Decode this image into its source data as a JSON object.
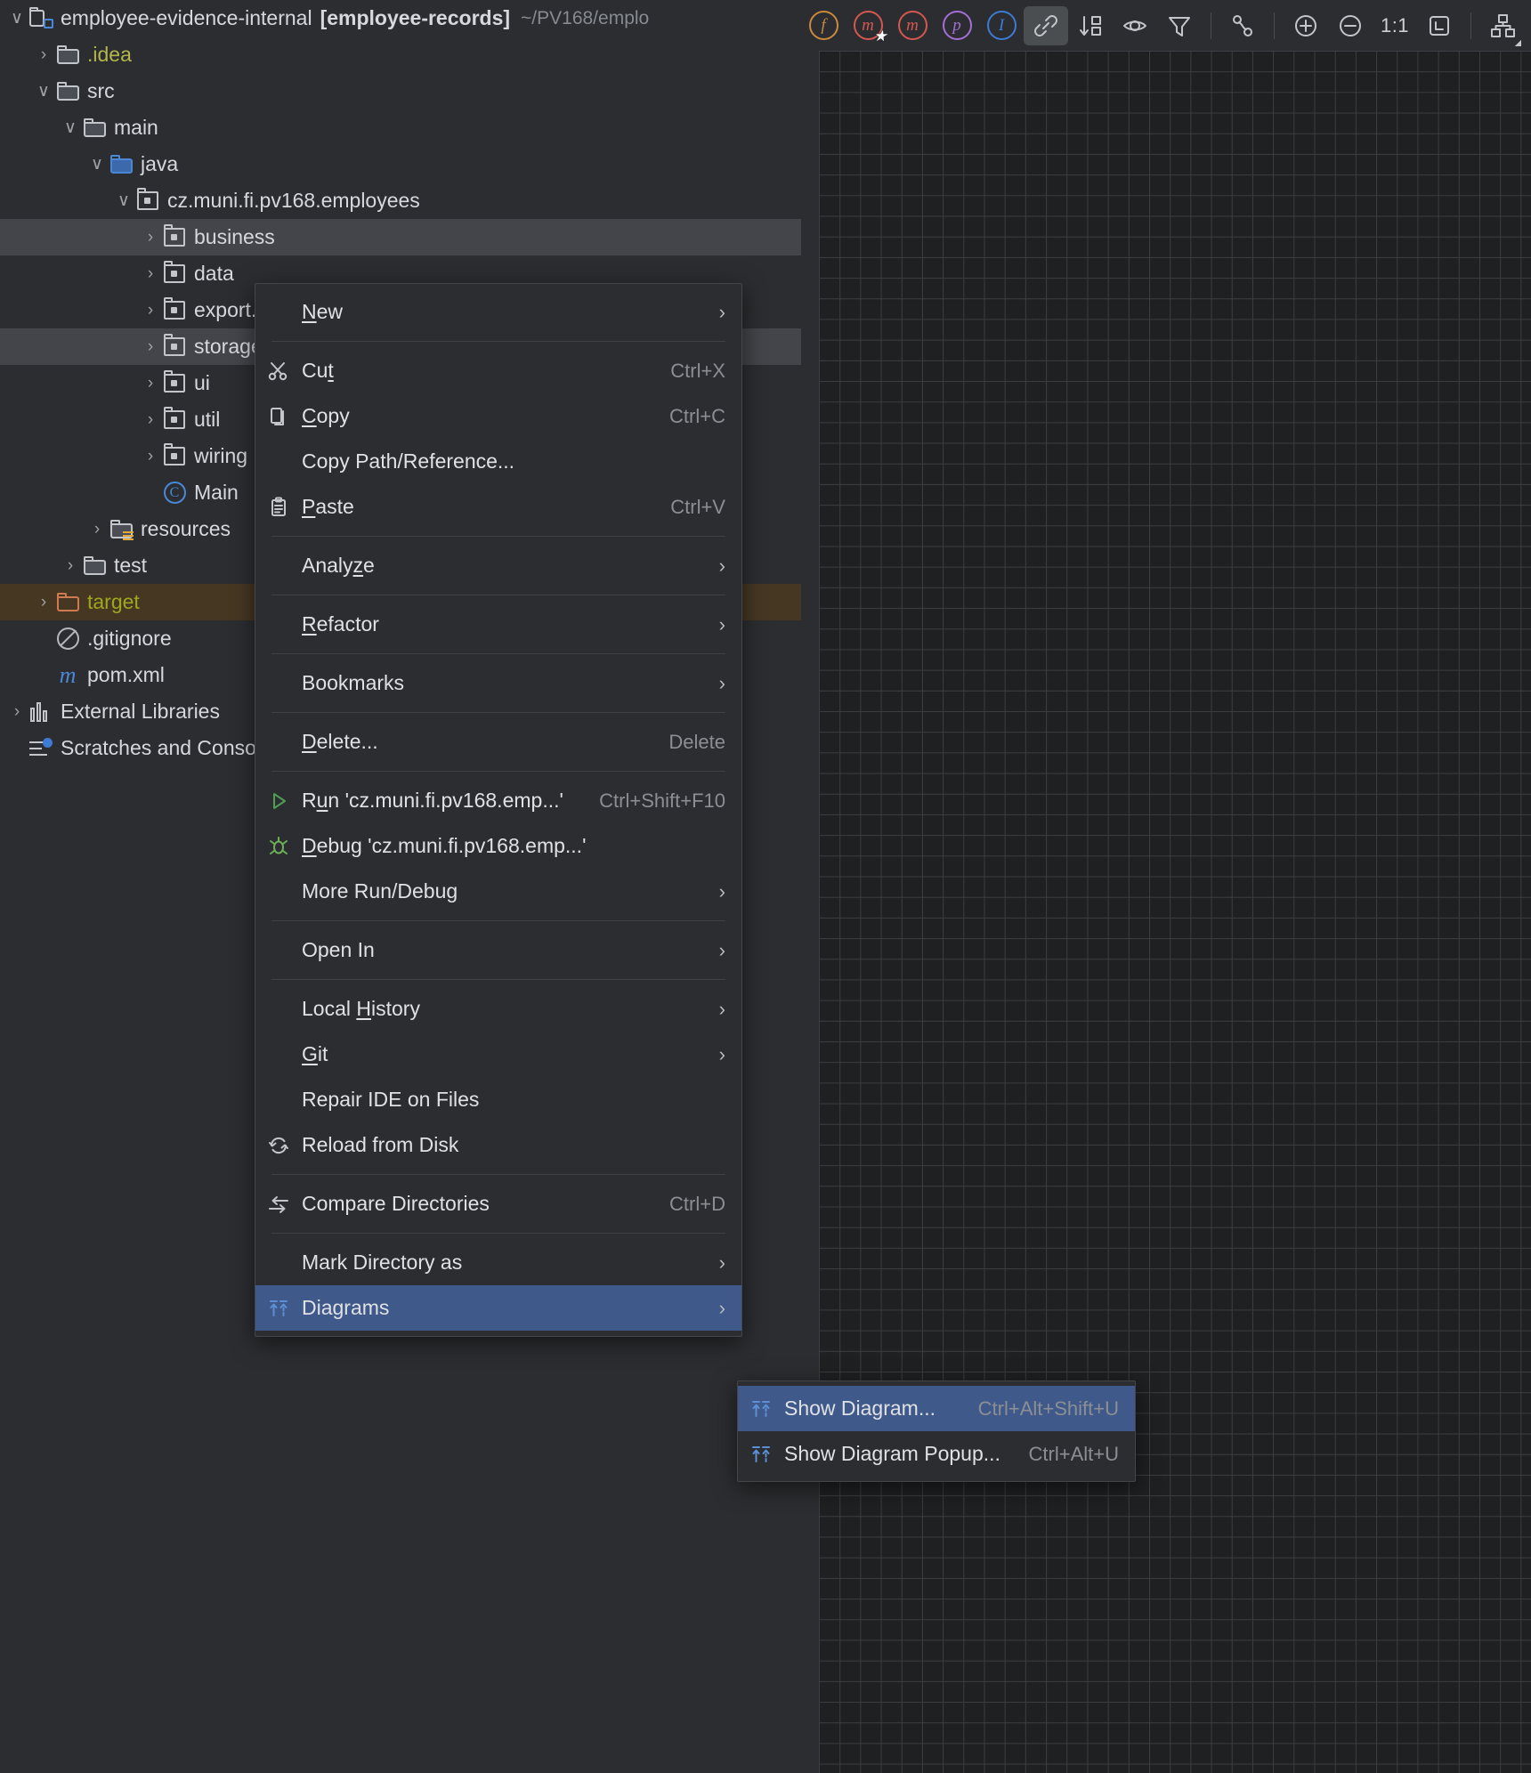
{
  "project": {
    "root": {
      "name": "employee-evidence-internal",
      "module": "[employee-records]",
      "path": "~/PV168/emplo",
      "icon": "project-icon"
    },
    "tree": [
      {
        "label": ".idea",
        "icon": "folder-icon",
        "chevron": "›",
        "indent": 1,
        "color": "yellowgreen"
      },
      {
        "label": "src",
        "icon": "folder-icon",
        "chevron": "∨",
        "indent": 1,
        "color": ""
      },
      {
        "label": "main",
        "icon": "folder-icon",
        "chevron": "∨",
        "indent": 2,
        "color": ""
      },
      {
        "label": "java",
        "icon": "folder-blue-icon",
        "chevron": "∨",
        "indent": 3,
        "color": ""
      },
      {
        "label": "cz.muni.fi.pv168.employees",
        "icon": "package-icon",
        "chevron": "∨",
        "indent": 4,
        "color": ""
      },
      {
        "label": "business",
        "icon": "package-icon",
        "chevron": "›",
        "indent": 5,
        "color": "",
        "selected": "grey"
      },
      {
        "label": "data",
        "icon": "package-icon",
        "chevron": "›",
        "indent": 5,
        "color": ""
      },
      {
        "label": "export.csv",
        "icon": "package-icon",
        "chevron": "›",
        "indent": 5,
        "color": ""
      },
      {
        "label": "storage",
        "icon": "package-icon",
        "chevron": "›",
        "indent": 5,
        "color": "",
        "selected": "grey"
      },
      {
        "label": "ui",
        "icon": "package-icon",
        "chevron": "›",
        "indent": 5,
        "color": ""
      },
      {
        "label": "util",
        "icon": "package-icon",
        "chevron": "›",
        "indent": 5,
        "color": ""
      },
      {
        "label": "wiring",
        "icon": "package-icon",
        "chevron": "›",
        "indent": 5,
        "color": ""
      },
      {
        "label": "Main",
        "icon": "java-class-icon",
        "chevron": "",
        "indent": 5,
        "color": ""
      },
      {
        "label": "resources",
        "icon": "resources-folder-icon",
        "chevron": "›",
        "indent": 3,
        "color": ""
      },
      {
        "label": "test",
        "icon": "folder-icon",
        "chevron": "›",
        "indent": 2,
        "color": ""
      },
      {
        "label": "target",
        "icon": "folder-excluded-icon",
        "chevron": "›",
        "indent": 1,
        "color": "olive",
        "selected": "target"
      },
      {
        "label": ".gitignore",
        "icon": "gitignore-icon",
        "chevron": "",
        "indent": 1,
        "color": ""
      },
      {
        "label": "pom.xml",
        "icon": "maven-icon",
        "chevron": "",
        "indent": 1,
        "color": ""
      },
      {
        "label": "External Libraries",
        "icon": "library-icon",
        "chevron": "›",
        "indent": 0,
        "color": ""
      },
      {
        "label": "Scratches and Console",
        "icon": "scratches-icon",
        "chevron": "",
        "indent": 0,
        "color": ""
      }
    ]
  },
  "toolbar": {
    "buttons": [
      {
        "name": "field-filter-icon",
        "glyph": "f",
        "color": "#c98a3c",
        "badge": ""
      },
      {
        "name": "method-filter-icon",
        "glyph": "m",
        "color": "#d4584f",
        "badge": "★"
      },
      {
        "name": "member-filter-icon",
        "glyph": "m",
        "color": "#d4584f",
        "badge": ""
      },
      {
        "name": "property-filter-icon",
        "glyph": "p",
        "color": "#a46fd4",
        "badge": ""
      },
      {
        "name": "inner-class-filter-icon",
        "glyph": "I",
        "color": "#3d7bd4",
        "badge": ""
      }
    ],
    "dependencies_label": "link-icon",
    "sort-icon": "sort-icon",
    "visibility-icon": "eye-icon",
    "filter-icon": "funnel-icon",
    "edges-icon": "edges-icon",
    "zoom_in": "plus-icon",
    "zoom_out": "minus-icon",
    "zoom_actual": "1:1",
    "fit_content": "fit-content-icon",
    "layout": "layout-icon"
  },
  "context_menu": {
    "items": [
      {
        "label": "New",
        "icon": "",
        "shortcut": "",
        "arrow": true,
        "mnemonic": "N",
        "sep_after": true
      },
      {
        "label": "Cut",
        "icon": "scissors-icon",
        "shortcut": "Ctrl+X",
        "arrow": false,
        "mnemonic": "t"
      },
      {
        "label": "Copy",
        "icon": "copy-icon",
        "shortcut": "Ctrl+C",
        "arrow": false,
        "mnemonic": "C"
      },
      {
        "label": "Copy Path/Reference...",
        "icon": "",
        "shortcut": "",
        "arrow": false
      },
      {
        "label": "Paste",
        "icon": "paste-icon",
        "shortcut": "Ctrl+V",
        "arrow": false,
        "mnemonic": "P",
        "sep_after": true
      },
      {
        "label": "Analyze",
        "icon": "",
        "shortcut": "",
        "arrow": true,
        "mnemonic": "z",
        "sep_after": true
      },
      {
        "label": "Refactor",
        "icon": "",
        "shortcut": "",
        "arrow": true,
        "mnemonic": "R",
        "sep_after": true
      },
      {
        "label": "Bookmarks",
        "icon": "",
        "shortcut": "",
        "arrow": true,
        "sep_after": true
      },
      {
        "label": "Delete...",
        "icon": "",
        "shortcut": "Delete",
        "arrow": false,
        "mnemonic": "D",
        "sep_after": true
      },
      {
        "label": "Run 'cz.muni.fi.pv168.emp...'",
        "icon": "run-icon",
        "shortcut": "Ctrl+Shift+F10",
        "arrow": false,
        "mnemonic": "u"
      },
      {
        "label": "Debug 'cz.muni.fi.pv168.emp...'",
        "icon": "debug-icon",
        "shortcut": "",
        "arrow": false,
        "mnemonic": "D"
      },
      {
        "label": "More Run/Debug",
        "icon": "",
        "shortcut": "",
        "arrow": true,
        "sep_after": true
      },
      {
        "label": "Open In",
        "icon": "",
        "shortcut": "",
        "arrow": true,
        "sep_after": true
      },
      {
        "label": "Local History",
        "icon": "",
        "shortcut": "",
        "arrow": true,
        "mnemonic": "H"
      },
      {
        "label": "Git",
        "icon": "",
        "shortcut": "",
        "arrow": true,
        "mnemonic": "G"
      },
      {
        "label": "Repair IDE on Files",
        "icon": "",
        "shortcut": "",
        "arrow": false
      },
      {
        "label": "Reload from Disk",
        "icon": "reload-icon",
        "shortcut": "",
        "arrow": false,
        "sep_after": true
      },
      {
        "label": "Compare Directories",
        "icon": "compare-icon",
        "shortcut": "Ctrl+D",
        "arrow": false,
        "sep_after": true
      },
      {
        "label": "Mark Directory as",
        "icon": "",
        "shortcut": "",
        "arrow": true
      },
      {
        "label": "Diagrams",
        "icon": "diagram-icon",
        "shortcut": "",
        "arrow": true,
        "highlight": true
      }
    ]
  },
  "submenu": {
    "items": [
      {
        "label": "Show Diagram...",
        "icon": "diagram-icon",
        "shortcut": "Ctrl+Alt+Shift+U",
        "highlight": true
      },
      {
        "label": "Show Diagram Popup...",
        "icon": "diagram-icon",
        "shortcut": "Ctrl+Alt+U",
        "highlight": false
      }
    ]
  },
  "colors": {
    "background": "#2b2d30",
    "canvas": "#1e2022",
    "grid_line": "#3b3e42",
    "selection": "#3f5a8a",
    "row_selected": "#43454a",
    "target_row": "#453722",
    "accent_blue": "#4a88d6"
  }
}
